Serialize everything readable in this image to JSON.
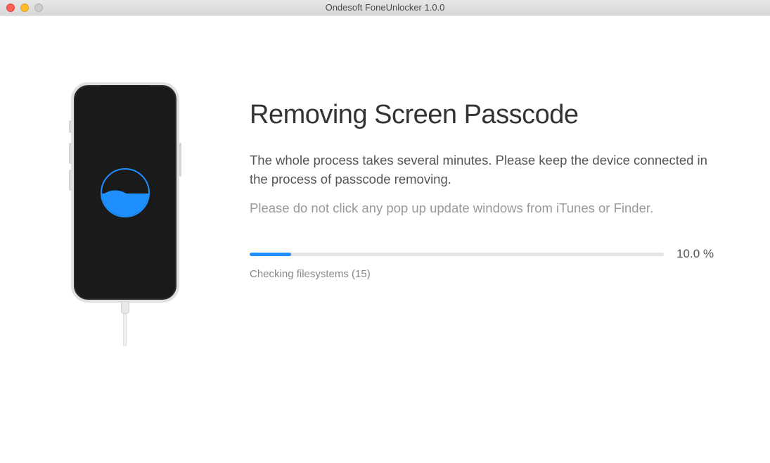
{
  "window": {
    "title": "Ondesoft FoneUnlocker 1.0.0"
  },
  "main": {
    "heading": "Removing Screen Passcode",
    "description": "The whole process takes several minutes. Please keep the device connected in the process of passcode removing.",
    "warning": "Please do not click any pop up update windows from iTunes or Finder.",
    "progress": {
      "percent_value": 10.0,
      "percent_label": "10.0 %",
      "status": "Checking filesystems (15)"
    }
  }
}
